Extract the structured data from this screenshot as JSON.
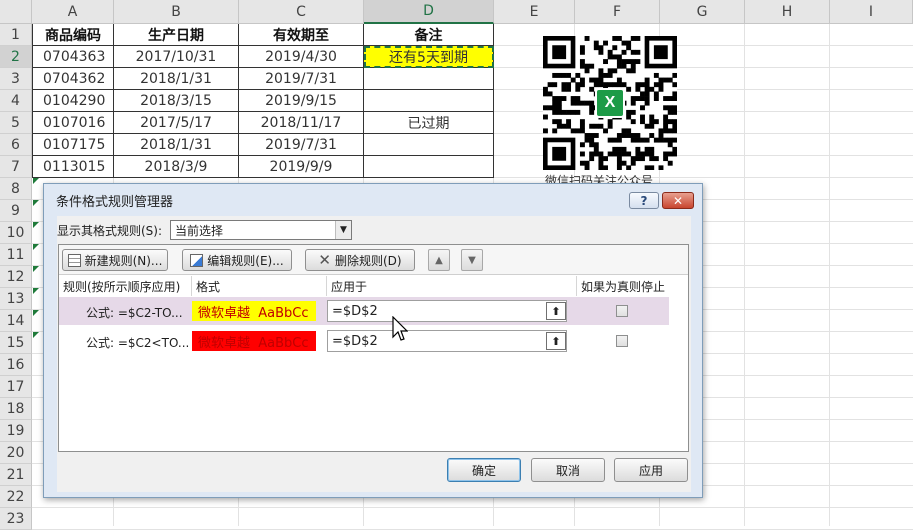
{
  "sheet": {
    "columns": [
      "A",
      "B",
      "C",
      "D",
      "E",
      "F",
      "G",
      "H",
      "I"
    ],
    "row_numbers": [
      "1",
      "2",
      "3",
      "4",
      "5",
      "6",
      "7",
      "8",
      "9",
      "10",
      "11",
      "12",
      "13",
      "14",
      "15",
      "16",
      "17",
      "18",
      "19",
      "20",
      "21",
      "22",
      "23"
    ],
    "header_row": [
      "商品编码",
      "生产日期",
      "有效期至",
      "备注"
    ],
    "rows": [
      {
        "a": "0704363",
        "b": "2017/10/31",
        "c": "2019/4/30",
        "d": "还有5天到期"
      },
      {
        "a": "0704362",
        "b": "2018/1/31",
        "c": "2019/7/31",
        "d": ""
      },
      {
        "a": "0104290",
        "b": "2018/3/15",
        "c": "2019/9/15",
        "d": ""
      },
      {
        "a": "0107016",
        "b": "2017/5/17",
        "c": "2018/11/17",
        "d": "已过期"
      },
      {
        "a": "0107175",
        "b": "2018/1/31",
        "c": "2019/7/31",
        "d": ""
      },
      {
        "a": "0113015",
        "b": "2018/3/9",
        "c": "2019/9/9",
        "d": ""
      }
    ],
    "highlight_color": "#ffff00"
  },
  "qr": {
    "caption": "微信扫码关注公众号",
    "badge": "X"
  },
  "dialog": {
    "title": "条件格式规则管理器",
    "help": "?",
    "close": "✕",
    "show_rules_label": "显示其格式规则(S):",
    "show_rules_value": "当前选择",
    "toolbar": {
      "new_rule": "新建规则(N)...",
      "edit_rule": "编辑规则(E)...",
      "delete_rule": "删除规则(D)",
      "up_icon": "▲",
      "down_icon": "▼"
    },
    "columns": {
      "rule": "规则(按所示顺序应用)",
      "format": "格式",
      "applies_to": "应用于",
      "stop_if_true": "如果为真则停止"
    },
    "rules": [
      {
        "rule": "公式: =$C2-TO...",
        "format_text": "微软卓越  AaBbCc",
        "applies_to": "=$D$2",
        "fill": "#ffff00",
        "text_color": "#c00000"
      },
      {
        "rule": "公式: =$C2<TO...",
        "format_text": "微软卓越  AaBbCc",
        "applies_to": "=$D$2",
        "fill": "#ff0000",
        "text_color": "#c00000"
      }
    ],
    "collapse_icon": "⬆",
    "buttons": {
      "ok": "确定",
      "cancel": "取消",
      "apply": "应用"
    }
  }
}
